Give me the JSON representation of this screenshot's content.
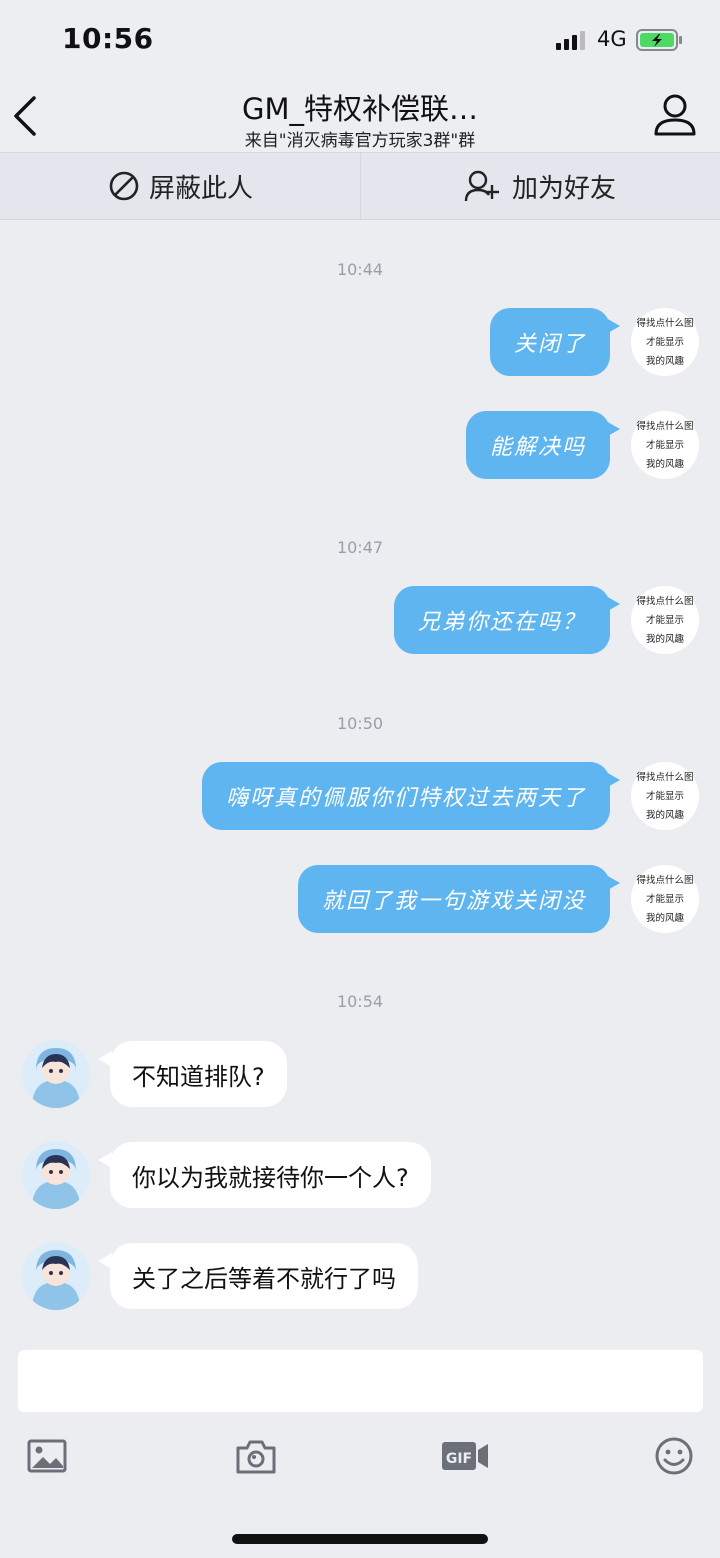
{
  "status": {
    "time": "10:56",
    "network": "4G"
  },
  "nav": {
    "title": "GM_特权补偿联…",
    "subtitle": "来自\"消灭病毒官方玩家3群\"群"
  },
  "actions": {
    "block_label": "屏蔽此人",
    "add_friend_label": "加为好友"
  },
  "self_avatar_text": [
    "得找点什么图",
    "才能显示",
    "我的风趣"
  ],
  "chat": {
    "ts1": "10:44",
    "m1": "关闭了",
    "m2": "能解决吗",
    "ts2": "10:47",
    "m3": "兄弟你还在吗？",
    "ts3": "10:50",
    "m4": "嗨呀真的佩服你们特权过去两天了",
    "m5": "就回了我一句游戏关闭没",
    "ts4": "10:54",
    "r1": "不知道排队?",
    "r2": "你以为我就接待你一个人?",
    "r3": "关了之后等着不就行了吗"
  },
  "colors": {
    "bubble_out": "#5fb5ef",
    "bubble_in": "#ffffff",
    "background": "#ebedf1",
    "battery": "#4cd964"
  },
  "toolbar_icons": [
    "image-icon",
    "camera-icon",
    "gif-icon",
    "emoji-icon"
  ]
}
